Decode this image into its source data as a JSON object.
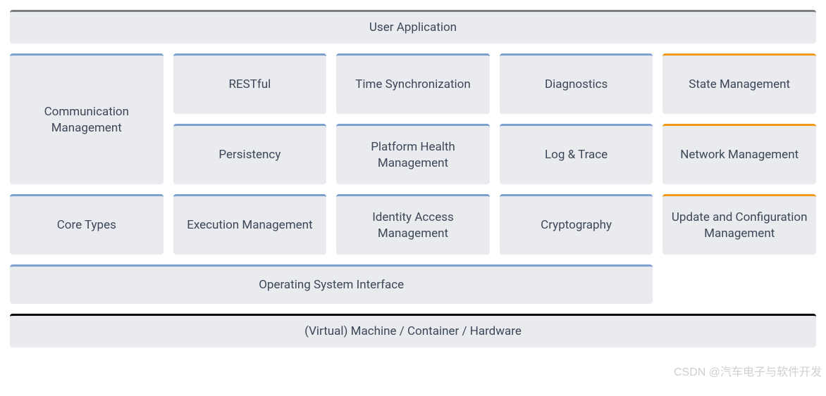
{
  "top": {
    "user_application": "User Application"
  },
  "grid": {
    "communication_management": "Communication Management",
    "restful": "RESTful",
    "time_sync": "Time Synchronization",
    "diagnostics": "Diagnostics",
    "state_management": "State Management",
    "persistency": "Persistency",
    "platform_health": "Platform Health Management",
    "log_trace": "Log & Trace",
    "network_management": "Network Management",
    "core_types": "Core Types",
    "execution_management": "Execution Management",
    "identity_access": "Identity Access Management",
    "cryptography": "Cryptography",
    "update_config": "Update and Configuration Management"
  },
  "os_interface": "Operating System Interface",
  "hardware": "(Virtual) Machine / Container / Hardware",
  "watermark": "CSDN @汽车电子与软件开发"
}
